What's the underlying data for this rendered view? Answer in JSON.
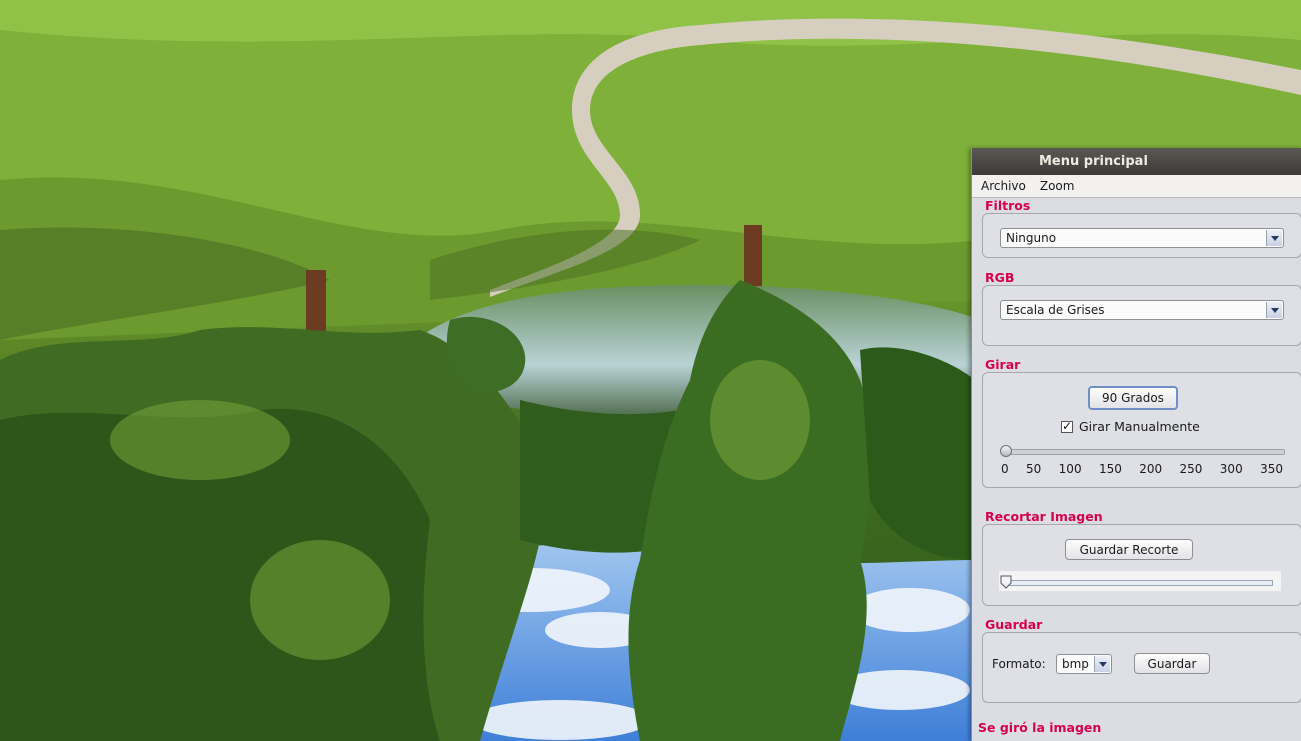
{
  "window": {
    "title": "Menu principal"
  },
  "menu": {
    "items": [
      "Archivo",
      "Zoom"
    ]
  },
  "sections": {
    "filtros": {
      "title": "Filtros",
      "selected": "Ninguno"
    },
    "rgb": {
      "title": "RGB",
      "selected": "Escala de Grises"
    },
    "girar": {
      "title": "Girar",
      "button_label": "90 Grados",
      "checkbox_label": "Girar Manualmente",
      "checkbox_checked": true,
      "slider_value": 0,
      "slider_min": 0,
      "slider_max": 350,
      "ticks": [
        "0",
        "50",
        "100",
        "150",
        "200",
        "250",
        "300",
        "350"
      ]
    },
    "recortar": {
      "title": "Recortar Imagen",
      "button_label": "Guardar Recorte",
      "slider_value": 0
    },
    "guardar": {
      "title": "Guardar",
      "format_label": "Formato:",
      "format_selected": "bmp",
      "button_label": "Guardar"
    }
  },
  "status": {
    "text": "Se giró la imagen"
  },
  "colors": {
    "section_title": "#d6004f",
    "titlebar": "#3d3b37",
    "panel_bg": "#dcdde4"
  },
  "icons": [
    "dropdown-arrow-icon",
    "checkmark-icon",
    "slider-knob-icon"
  ]
}
